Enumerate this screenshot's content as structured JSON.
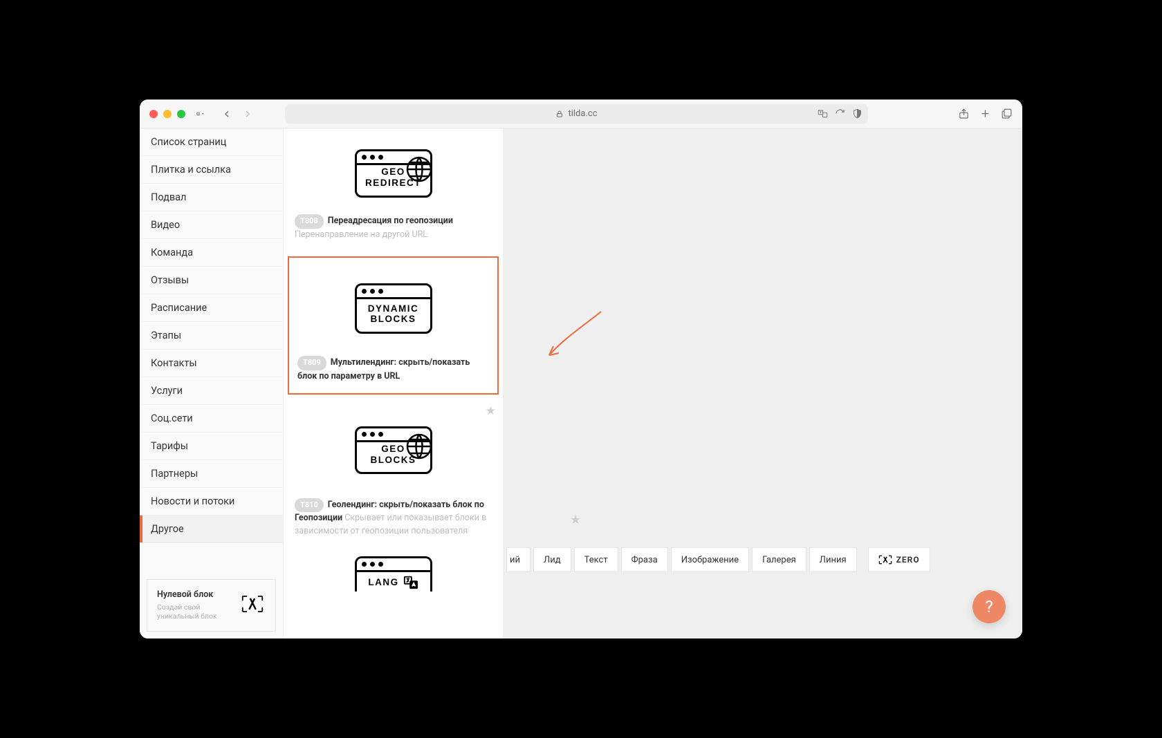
{
  "browser": {
    "url": "tilda.cc"
  },
  "sidebar": {
    "items": [
      {
        "label": "Список страниц"
      },
      {
        "label": "Плитка и ссылка"
      },
      {
        "label": "Подвал"
      },
      {
        "label": "Видео"
      },
      {
        "label": "Команда"
      },
      {
        "label": "Отзывы"
      },
      {
        "label": "Расписание"
      },
      {
        "label": "Этапы"
      },
      {
        "label": "Контакты"
      },
      {
        "label": "Услуги"
      },
      {
        "label": "Соц.сети"
      },
      {
        "label": "Тарифы"
      },
      {
        "label": "Партнеры"
      },
      {
        "label": "Новости и потоки"
      },
      {
        "label": "Другое",
        "active": true
      }
    ],
    "zero": {
      "title": "Нулевой блок",
      "sub": "Создай свой уникальный блок"
    }
  },
  "blocks": [
    {
      "code": "T808",
      "title": "Переадресация по геопозиции",
      "desc": "Перенаправление на другой URL",
      "preview_label": "GEO\nREDIRECT",
      "has_globe": true
    },
    {
      "code": "T809",
      "title": "Мультилендинг: скрыть/показать блок по параметру в URL",
      "desc": "",
      "preview_label": "DYNAMIC\nBLOCKS",
      "has_globe": false,
      "highlighted": true
    },
    {
      "code": "T810",
      "title": "Геолендинг: скрыть/показать блок по Геопозиции",
      "desc": "Скрывает или показывает блоки в зависимости от геопозиции пользователя",
      "preview_label": "GEO\nBLOCKS",
      "has_globe": true,
      "has_star": true
    },
    {
      "code": "",
      "title": "",
      "desc": "",
      "preview_label": "LANG",
      "has_globe": false,
      "has_lang_icon": true
    }
  ],
  "bottom_bar": {
    "items": [
      "ий",
      "Лид",
      "Текст",
      "Фраза",
      "Изображение",
      "Галерея",
      "Линия"
    ],
    "zero_label": "ZERO"
  },
  "colors": {
    "accent": "#ee6a3a"
  }
}
